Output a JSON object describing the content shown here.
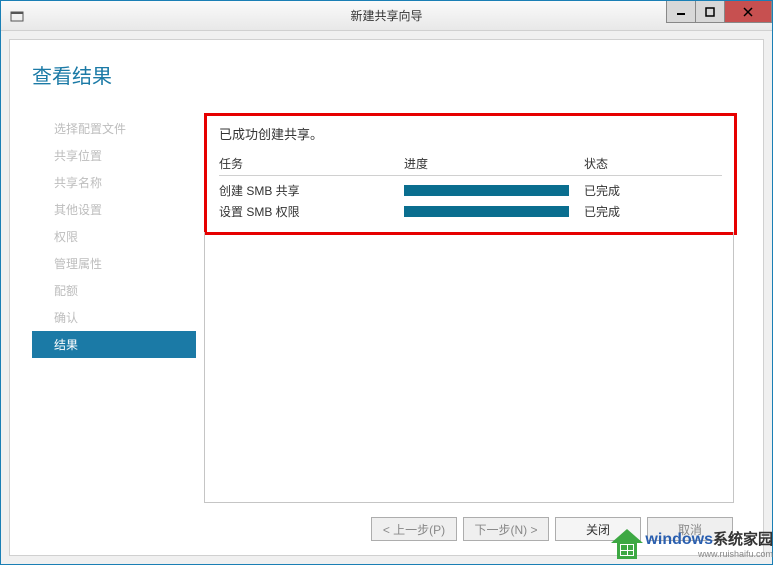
{
  "window": {
    "title": "新建共享向导"
  },
  "heading": "查看结果",
  "sidebar": {
    "items": [
      {
        "label": "选择配置文件",
        "active": false
      },
      {
        "label": "共享位置",
        "active": false
      },
      {
        "label": "共享名称",
        "active": false
      },
      {
        "label": "其他设置",
        "active": false
      },
      {
        "label": "权限",
        "active": false
      },
      {
        "label": "管理属性",
        "active": false
      },
      {
        "label": "配额",
        "active": false
      },
      {
        "label": "确认",
        "active": false
      },
      {
        "label": "结果",
        "active": true
      }
    ]
  },
  "main": {
    "message": "已成功创建共享。",
    "columns": {
      "task": "任务",
      "progress": "进度",
      "status": "状态"
    },
    "tasks": [
      {
        "name": "创建 SMB 共享",
        "progress": 100,
        "status": "已完成"
      },
      {
        "name": "设置 SMB 权限",
        "progress": 100,
        "status": "已完成"
      }
    ]
  },
  "footer": {
    "prev": "< 上一步(P)",
    "next": "下一步(N) >",
    "close": "关闭",
    "cancel": "取消"
  },
  "branding": {
    "main": "windows",
    "cn": "系统家园",
    "sub": "www.ruishaifu.com"
  }
}
